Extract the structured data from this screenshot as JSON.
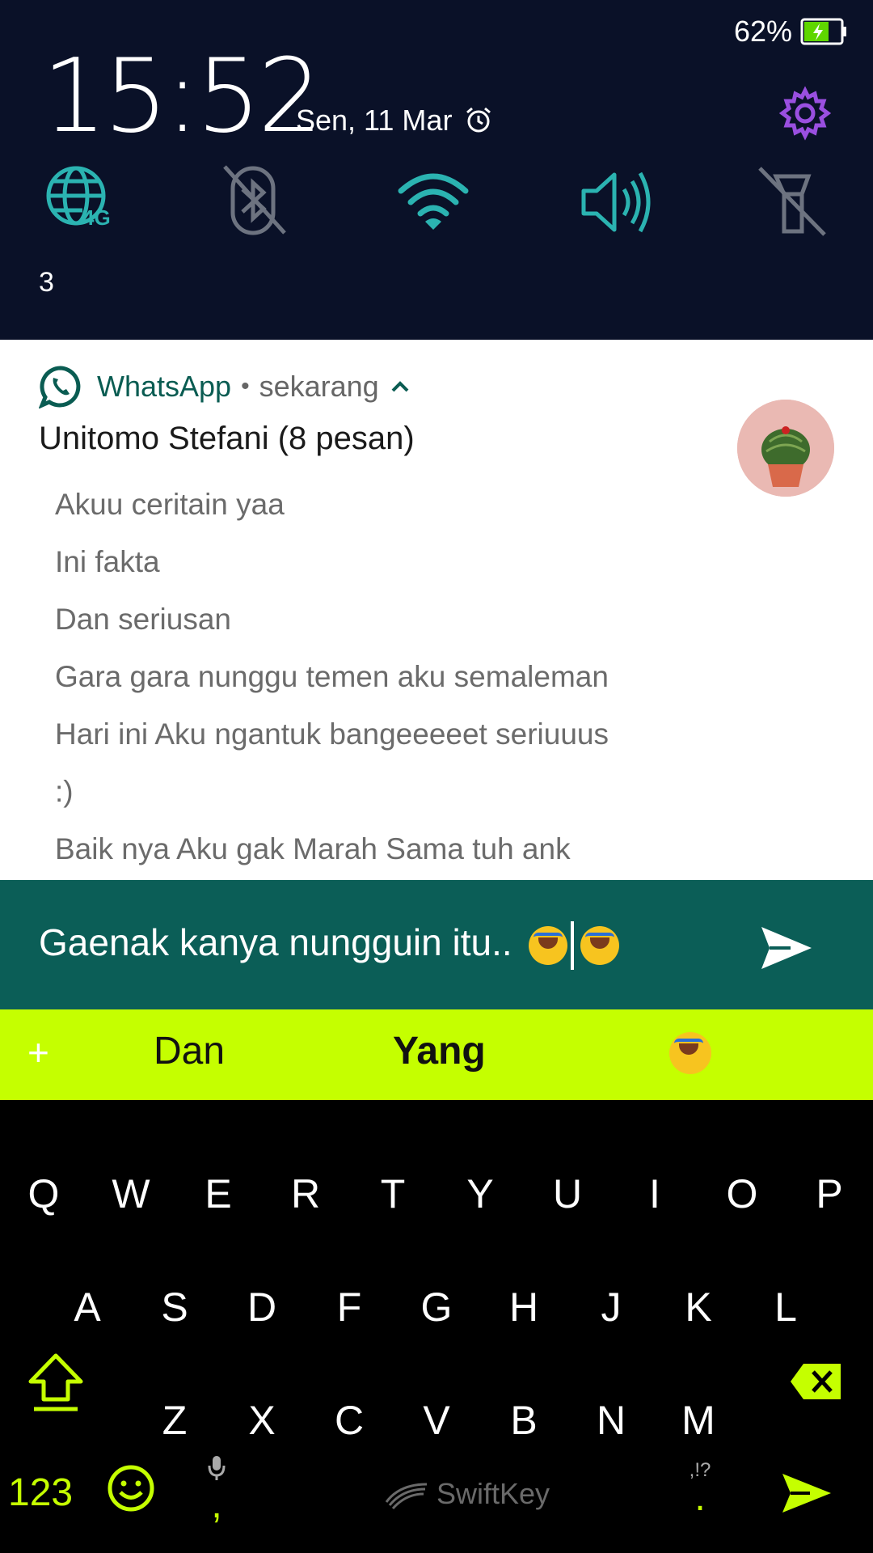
{
  "status_bar": {
    "battery_percent": "62%",
    "battery_level": 0.62,
    "battery_color": "#5fd600"
  },
  "shade": {
    "time": "15:52",
    "date": "Sen, 11 Mar",
    "quick_settings": [
      {
        "icon": "mobile-data-4g-icon",
        "state": "on",
        "label": "4G"
      },
      {
        "icon": "bluetooth-off-icon",
        "state": "off"
      },
      {
        "icon": "wifi-icon",
        "state": "on"
      },
      {
        "icon": "volume-icon",
        "state": "on"
      },
      {
        "icon": "flashlight-off-icon",
        "state": "off"
      }
    ],
    "notification_count": "3",
    "accent_color": "#2bb3b1",
    "settings_color": "#9a4fe0"
  },
  "notification": {
    "app_name": "WhatsApp",
    "separator": "•",
    "time": "sekarang",
    "title": "Unitomo Stefani (8 pesan)",
    "messages": [
      "Akuu ceritain yaa",
      "Ini fakta",
      "Dan seriusan",
      "Gara gara nunggu temen aku semaleman",
      "Hari ini Aku ngantuk bangeeeeet seriuuus",
      ":)",
      "Baik nya Aku gak Marah Sama tuh ank"
    ]
  },
  "reply": {
    "text": "Gaenak kanya nungguin itu.."
  },
  "suggestions": {
    "left": "Dan",
    "center": "Yang",
    "right_emoji": "rolling-on-floor-laughing-emoji"
  },
  "keyboard": {
    "row1": [
      "Q",
      "W",
      "E",
      "R",
      "T",
      "Y",
      "U",
      "I",
      "O",
      "P"
    ],
    "row2": [
      "A",
      "S",
      "D",
      "F",
      "G",
      "H",
      "J",
      "K",
      "L"
    ],
    "row3": [
      "Z",
      "X",
      "C",
      "V",
      "B",
      "N",
      "M"
    ],
    "numbers_key": "123",
    "comma": ",",
    "brand": "SwiftKey",
    "punct_hint": ",!?",
    "period": ".",
    "accent_color": "#c5ff00"
  }
}
